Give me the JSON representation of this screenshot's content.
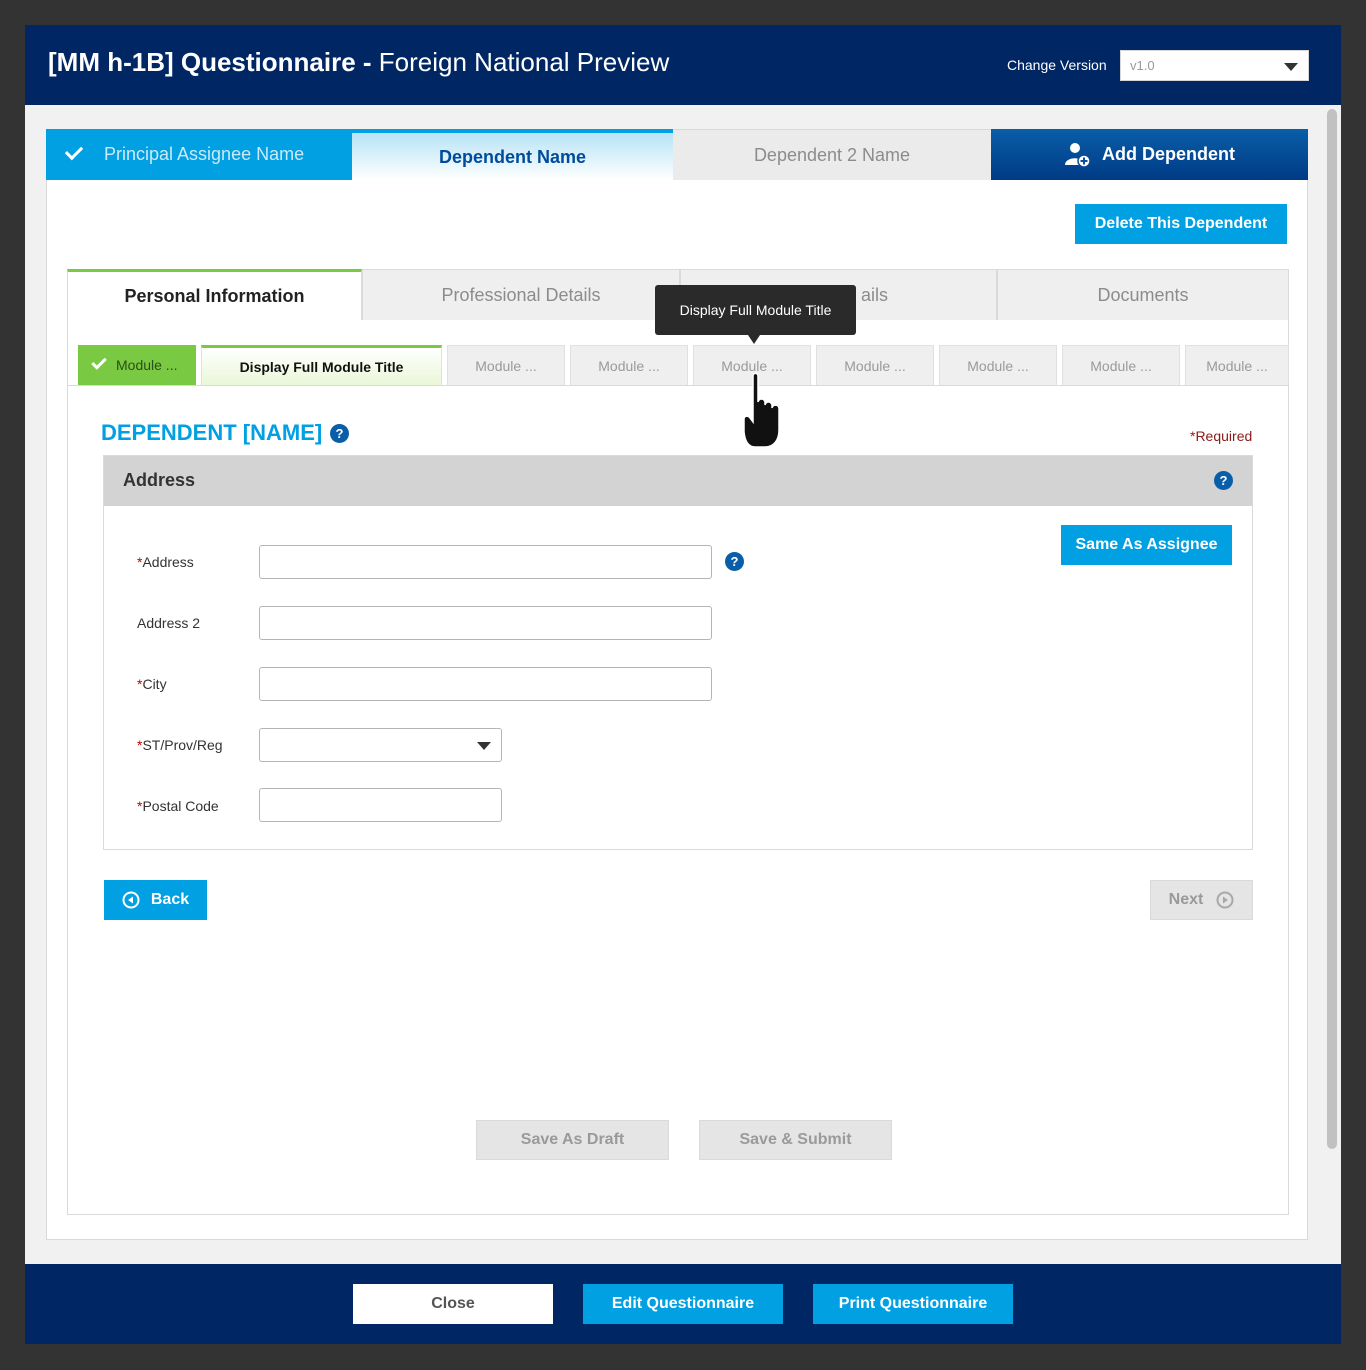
{
  "header": {
    "title_bold": "[MM h-1B] Questionnaire -",
    "title_rest": "Foreign National Preview",
    "change_version_label": "Change Version",
    "version_value": "v1.0"
  },
  "dependent_tabs": {
    "principal": "Principal Assignee Name",
    "dependent": "Dependent Name",
    "dependent2": "Dependent 2 Name",
    "add": "Add Dependent"
  },
  "delete_button": "Delete This Dependent",
  "section_tabs": {
    "personal": "Personal Information",
    "professional": "Professional Details",
    "third_partial": "ails",
    "documents": "Documents"
  },
  "modules": {
    "m1": "Module ...",
    "m2": "Display Full Module Title",
    "m3": "Module ...",
    "m4": "Module ...",
    "m5": "Module ...",
    "m6": "Module ...",
    "m7": "Module ...",
    "m8": "Module ...",
    "m9": "Module ..."
  },
  "tooltip": "Display Full Module Title",
  "section_title": "DEPENDENT [NAME]",
  "required_note": "*Required",
  "panel": {
    "title": "Address",
    "same_as_button": "Same As Assignee",
    "fields": {
      "address": "Address",
      "address2": "Address 2",
      "city": "City",
      "state": "ST/Prov/Reg",
      "postal": "Postal Code"
    },
    "required_mark": "*"
  },
  "nav": {
    "back": "Back",
    "next": "Next"
  },
  "actions": {
    "save_draft": "Save As Draft",
    "save_submit": "Save & Submit"
  },
  "footer": {
    "close": "Close",
    "edit": "Edit Questionnaire",
    "print": "Print Questionnaire"
  },
  "colors": {
    "brand_navy": "#002664",
    "accent_blue": "#00a0e3",
    "accent_green": "#7ac943"
  }
}
